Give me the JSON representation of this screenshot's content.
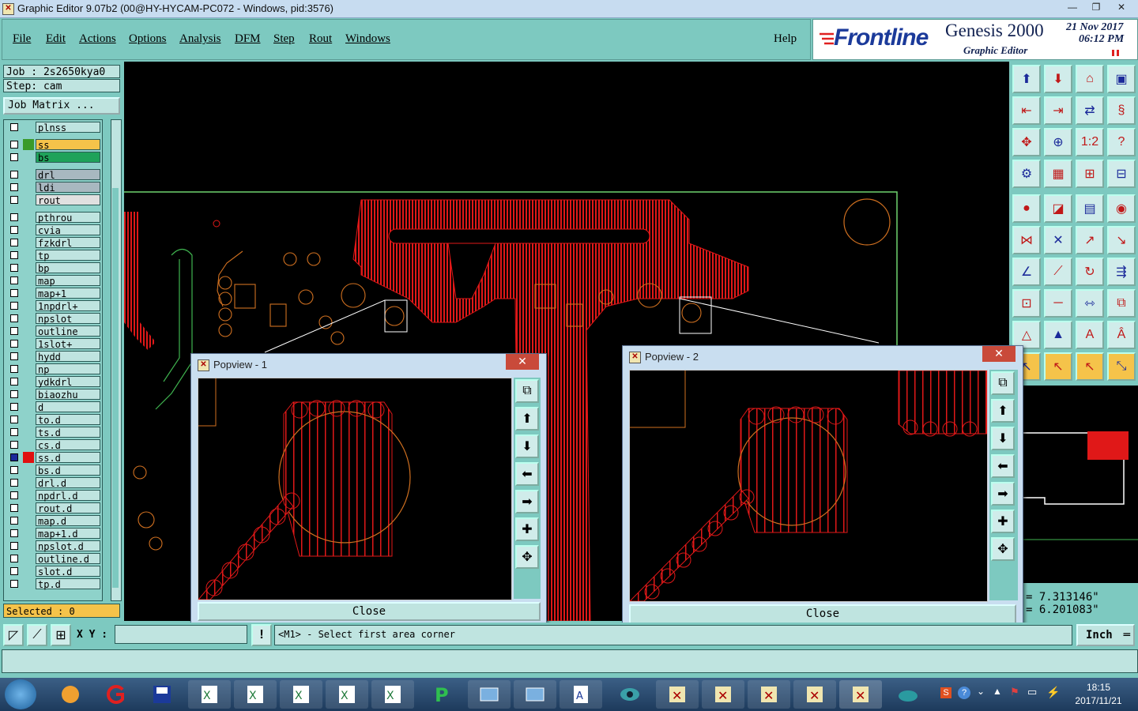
{
  "window": {
    "title": "Graphic Editor 9.07b2 (00@HY-HYCAM-PC072 - Windows, pid:3576)"
  },
  "menu": {
    "items": [
      "File",
      "Edit",
      "Actions",
      "Options",
      "Analysis",
      "DFM",
      "Step",
      "Rout",
      "Windows"
    ],
    "help": "Help"
  },
  "brand": {
    "company": "Frontline",
    "product": "Genesis 2000",
    "subtitle": "Graphic Editor",
    "date": "21 Nov 2017",
    "time": "06:12 PM"
  },
  "job": {
    "job_label": "Job : 2s2650kya0",
    "step_label": "Step: cam",
    "matrix_button": "Job Matrix ..."
  },
  "layers": [
    {
      "name": "plnss",
      "color": "#bfe4e0"
    },
    {
      "name": "ss",
      "color": "#f5c34a",
      "swatch": "#3a9a2a"
    },
    {
      "name": "bs",
      "color": "#1fa25a"
    },
    {
      "name": "drl",
      "color": "#a8b8c0"
    },
    {
      "name": "ldi",
      "color": "#a8b8c0"
    },
    {
      "name": "rout",
      "color": "#e0e0e0"
    },
    {
      "name": "pthrou",
      "color": "#bfe4e0"
    },
    {
      "name": "cvia",
      "color": "#bfe4e0"
    },
    {
      "name": "fzkdrl",
      "color": "#bfe4e0"
    },
    {
      "name": "tp",
      "color": "#bfe4e0"
    },
    {
      "name": "bp",
      "color": "#bfe4e0"
    },
    {
      "name": "map",
      "color": "#bfe4e0"
    },
    {
      "name": "map+1",
      "color": "#bfe4e0"
    },
    {
      "name": "1npdrl+",
      "color": "#bfe4e0"
    },
    {
      "name": "npslot",
      "color": "#bfe4e0"
    },
    {
      "name": "outline",
      "color": "#bfe4e0"
    },
    {
      "name": "1slot+",
      "color": "#bfe4e0"
    },
    {
      "name": "hydd",
      "color": "#bfe4e0"
    },
    {
      "name": "np",
      "color": "#bfe4e0"
    },
    {
      "name": "ydkdrl",
      "color": "#bfe4e0"
    },
    {
      "name": "biaozhu",
      "color": "#bfe4e0"
    },
    {
      "name": "d",
      "color": "#bfe4e0"
    },
    {
      "name": "to.d",
      "color": "#bfe4e0"
    },
    {
      "name": "ts.d",
      "color": "#bfe4e0"
    },
    {
      "name": "cs.d",
      "color": "#bfe4e0"
    },
    {
      "name": "ss.d",
      "color": "#bfe4e0",
      "swatch": "#e01010",
      "checked": true
    },
    {
      "name": "bs.d",
      "color": "#bfe4e0"
    },
    {
      "name": "drl.d",
      "color": "#bfe4e0"
    },
    {
      "name": "npdrl.d",
      "color": "#bfe4e0"
    },
    {
      "name": "rout.d",
      "color": "#bfe4e0"
    },
    {
      "name": "map.d",
      "color": "#bfe4e0"
    },
    {
      "name": "map+1.d",
      "color": "#bfe4e0"
    },
    {
      "name": "npslot.d",
      "color": "#bfe4e0"
    },
    {
      "name": "outline.d",
      "color": "#bfe4e0"
    },
    {
      "name": "slot.d",
      "color": "#bfe4e0"
    },
    {
      "name": "tp.d",
      "color": "#bfe4e0"
    }
  ],
  "selected": "Selected : 0",
  "popups": [
    {
      "title": "Popview - 1",
      "close_label": "Close"
    },
    {
      "title": "Popview - 2",
      "close_label": "Close"
    }
  ],
  "coords": {
    "x": "7.313146\"",
    "y": "6.201083\""
  },
  "status": {
    "xy_label": "X Y :",
    "xy_value": "",
    "message": "<M1> - Select first area corner",
    "units": "Inch"
  },
  "clock": {
    "time": "18:15",
    "date": "2017/11/21"
  },
  "colors": {
    "copper": "#e01818",
    "outline": "#d07020",
    "board": "#000000",
    "panel": "#7dc9c0"
  }
}
